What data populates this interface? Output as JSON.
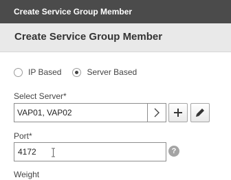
{
  "window": {
    "title": "Create Service Group Member"
  },
  "panel": {
    "heading": "Create Service Group Member"
  },
  "type_options": [
    {
      "label": "IP Based",
      "selected": false
    },
    {
      "label": "Server Based",
      "selected": true
    }
  ],
  "server": {
    "label": "Select Server*",
    "value": "VAP01, VAP02"
  },
  "port": {
    "label": "Port*",
    "value": "4172"
  },
  "weight": {
    "label": "Weight"
  },
  "icons": {
    "chevron": "chevron-right-icon",
    "add": "plus-icon",
    "edit": "pencil-icon",
    "help": "question-icon",
    "help_glyph": "?"
  }
}
